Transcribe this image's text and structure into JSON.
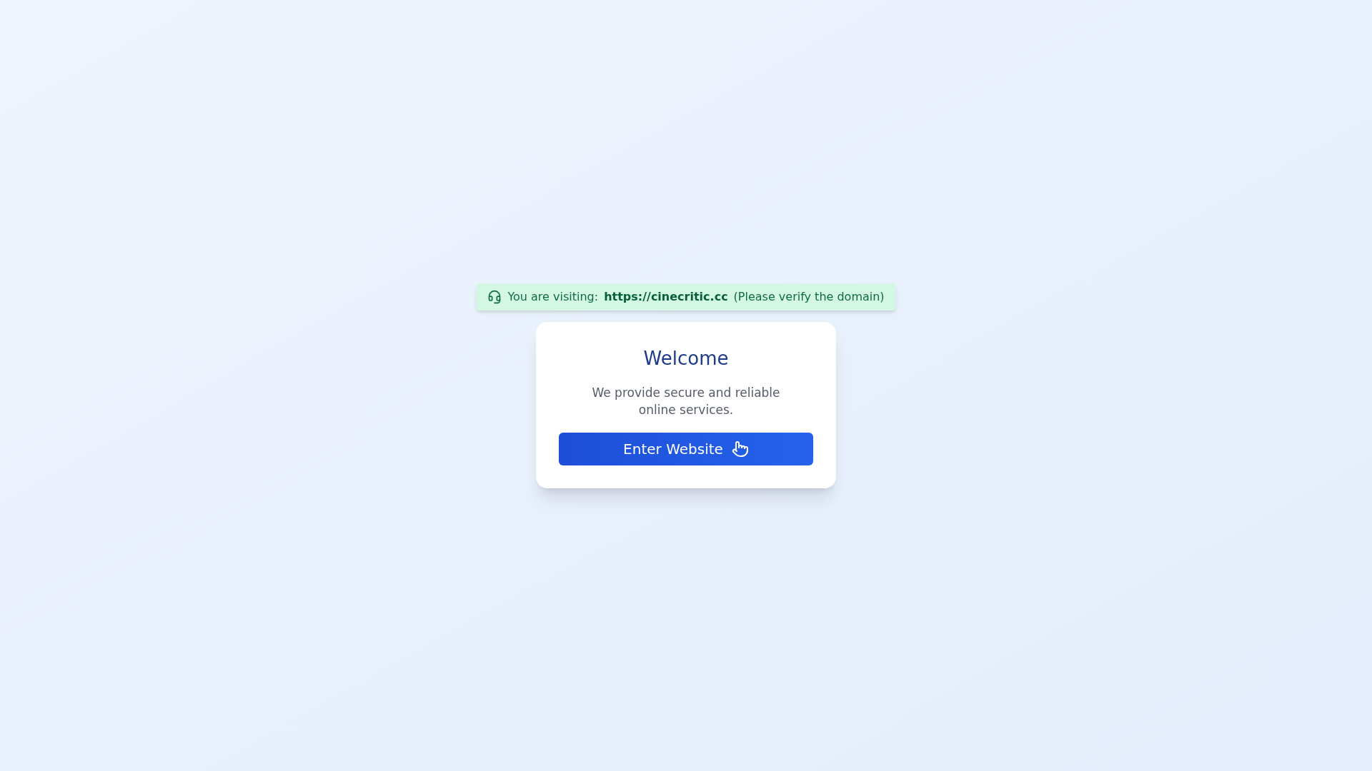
{
  "notice": {
    "label": "You are visiting:",
    "domain": "https://cinecritic.cc",
    "hint": "(Please verify the domain)"
  },
  "card": {
    "title": "Welcome",
    "description": "We provide secure and reliable online services.",
    "button": "Enter Website"
  }
}
